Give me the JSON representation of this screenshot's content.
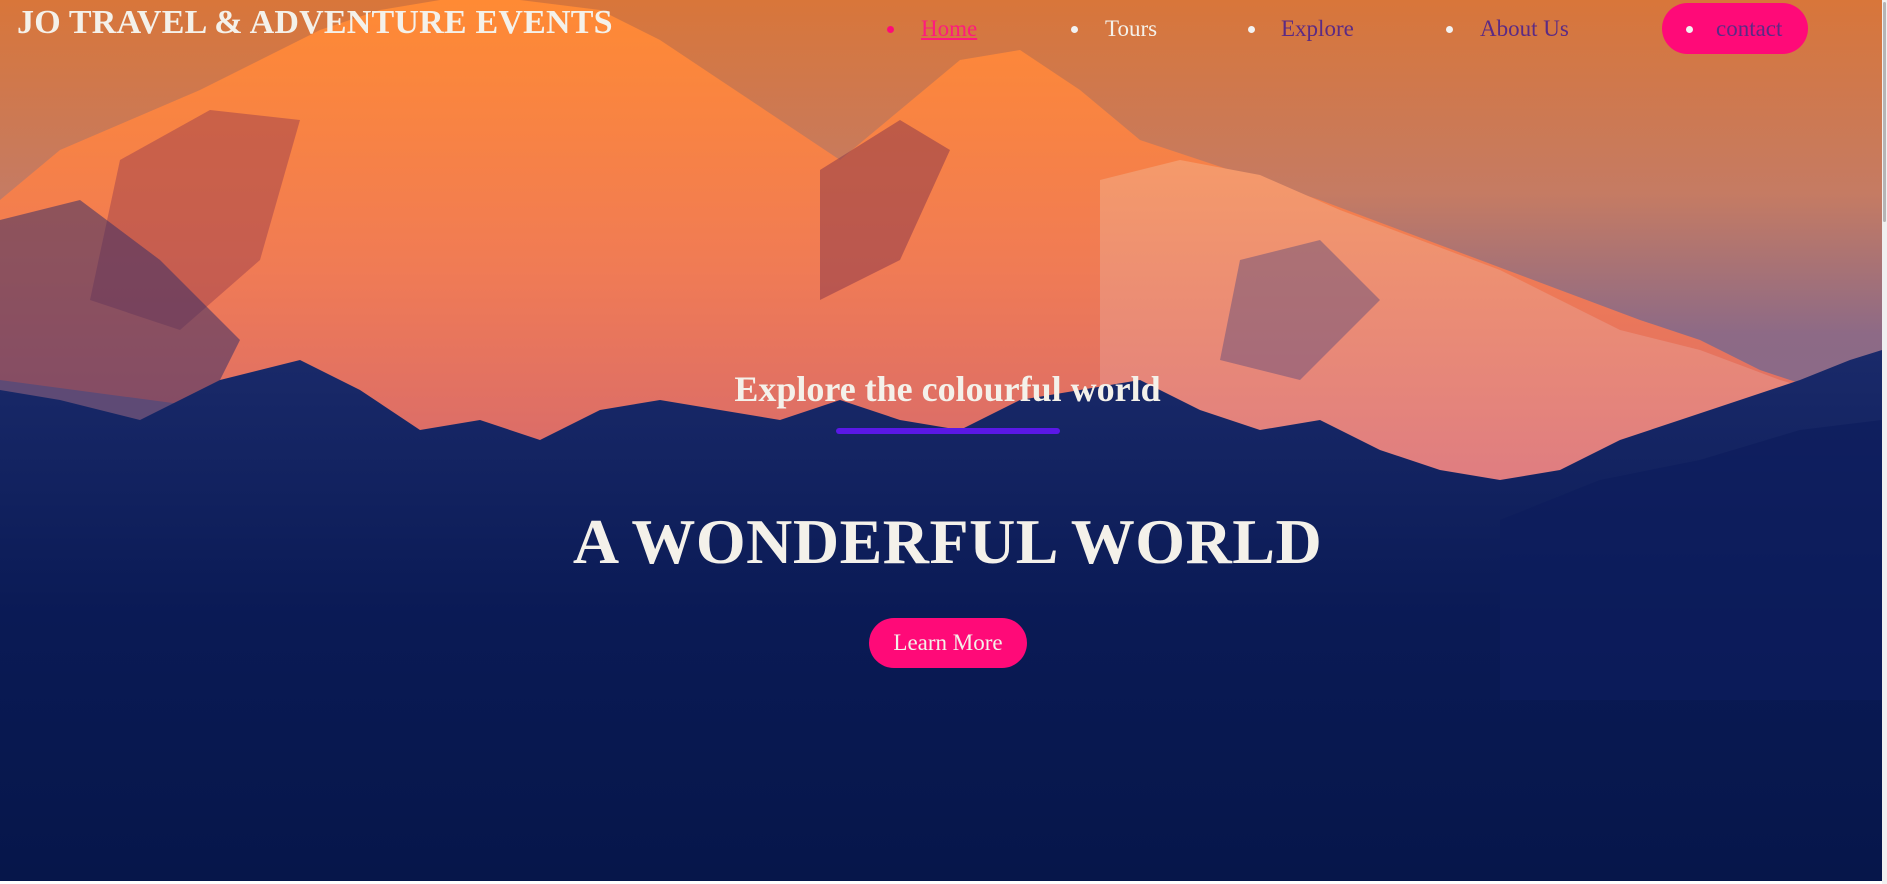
{
  "header": {
    "logo": "JO TRAVEL & ADVENTURE EVENTS"
  },
  "nav": {
    "items": [
      {
        "label": "Home",
        "active": true
      },
      {
        "label": "Tours"
      },
      {
        "label": "Explore"
      },
      {
        "label": "About Us"
      },
      {
        "label": "contact"
      }
    ]
  },
  "hero": {
    "subtitle": "Explore the colourful world",
    "headline": "A WONDERFUL WORLD",
    "cta_label": "Learn More"
  },
  "colors": {
    "accent": "#ff0a78",
    "underline": "#5a18e6",
    "nav_text": "#5b2a84",
    "hero_text": "#f4f1ea",
    "hero_dark": "#06164a"
  }
}
